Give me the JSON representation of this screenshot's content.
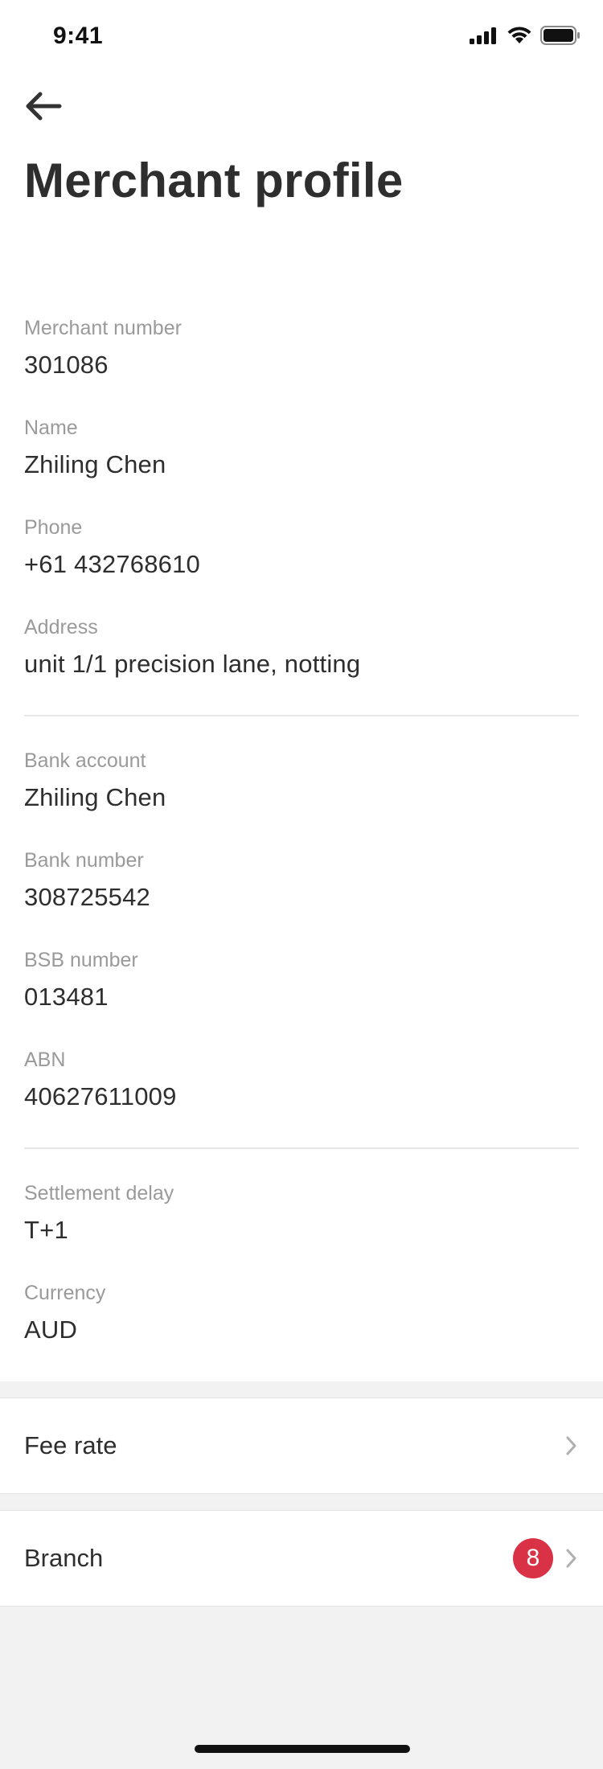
{
  "status_bar": {
    "time": "9:41"
  },
  "header": {
    "title": "Merchant profile"
  },
  "profile_fields": [
    {
      "label": "Merchant number",
      "value": "301086"
    },
    {
      "label": "Name",
      "value": "Zhiling Chen"
    },
    {
      "label": "Phone",
      "value": "+61 432768610"
    },
    {
      "label": "Address",
      "value": "unit 1/1 precision lane, notting"
    }
  ],
  "bank_fields": [
    {
      "label": "Bank account",
      "value": "Zhiling Chen"
    },
    {
      "label": "Bank number",
      "value": "308725542"
    },
    {
      "label": "BSB number",
      "value": "013481"
    },
    {
      "label": "ABN",
      "value": "40627611009"
    }
  ],
  "settlement_fields": [
    {
      "label": "Settlement delay",
      "value": "T+1"
    },
    {
      "label": "Currency",
      "value": "AUD"
    }
  ],
  "fee_rate_row": {
    "label": "Fee rate"
  },
  "branch_row": {
    "label": "Branch",
    "badge": "8"
  },
  "colors": {
    "badge": "#d93246",
    "label_gray": "#9a9a9a",
    "text_dark": "#2e2e2e",
    "background": "#f2f2f2"
  },
  "icons": [
    "cellular-signal-icon",
    "wifi-icon",
    "battery-icon",
    "back-arrow-icon",
    "chevron-right-icon"
  ]
}
